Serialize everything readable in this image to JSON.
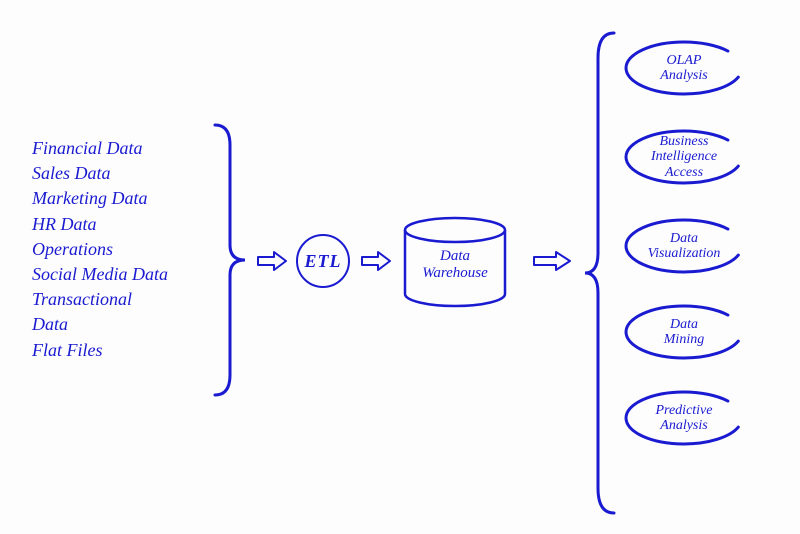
{
  "sources": [
    "Financial Data",
    "Sales Data",
    "Marketing Data",
    "HR Data",
    "Operations",
    "Social Media Data",
    "Transactional",
    "Data",
    "Flat Files"
  ],
  "etl_label": "ETL",
  "warehouse_label_line1": "Data",
  "warehouse_label_line2": "Warehouse",
  "outputs": [
    {
      "line1": "OLAP",
      "line2": "Analysis"
    },
    {
      "line1": "Business",
      "line2": "Intelligence",
      "line3": "Access"
    },
    {
      "line1": "Data",
      "line2": "Visualization"
    },
    {
      "line1": "Data",
      "line2": "Mining"
    },
    {
      "line1": "Predictive",
      "line2": "Analysis"
    }
  ],
  "colors": {
    "ink": "#1a1ad1"
  }
}
